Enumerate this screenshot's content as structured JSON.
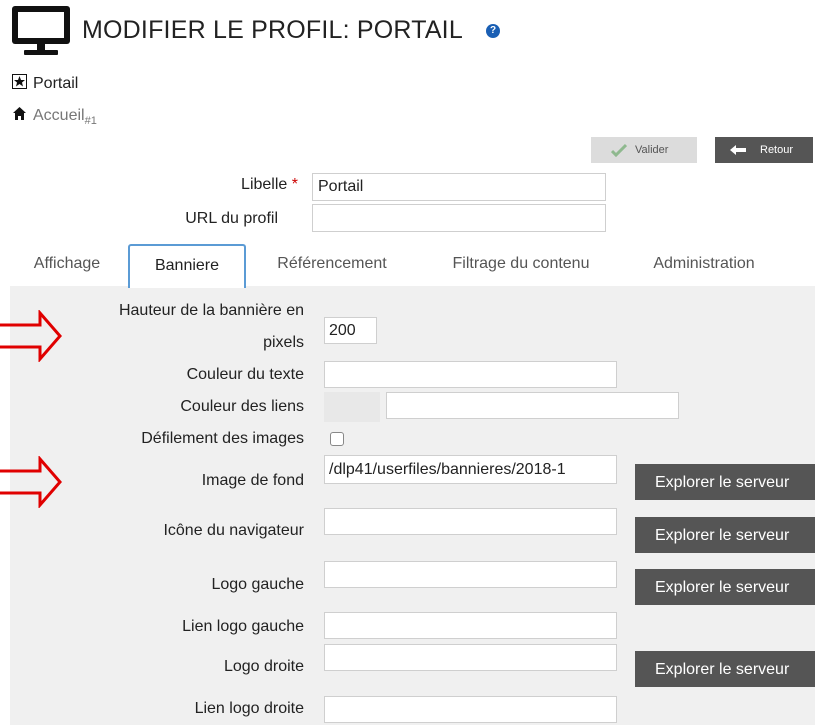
{
  "header": {
    "title": "MODIFIER LE PROFIL: PORTAIL",
    "help_icon": "?"
  },
  "breadcrumbs": {
    "portal": "Portail",
    "home": "Accueil",
    "home_id": "#1"
  },
  "actions": {
    "validate_label": "Valider",
    "back_label": "Retour"
  },
  "fields": {
    "libelle_label": "Libelle",
    "required_mark": "*",
    "libelle_value": "Portail",
    "url_label": "URL du profil",
    "url_value": ""
  },
  "tabs": [
    {
      "label": "Affichage"
    },
    {
      "label": "Banniere"
    },
    {
      "label": "Référencement"
    },
    {
      "label": "Filtrage du contenu"
    },
    {
      "label": "Administration"
    }
  ],
  "active_tab": "Banniere",
  "banner": {
    "height_label_line1": "Hauteur de la bannière en",
    "height_label_line2": "pixels",
    "height_value": "200",
    "text_color_label": "Couleur du texte",
    "text_color_value": "",
    "link_color_label": "Couleur des liens",
    "link_color_value": "",
    "scroll_label": "Défilement des images",
    "scroll_checked": false,
    "bg_image_label": "Image de fond",
    "bg_image_value": "/dlp41/userfiles/bannieres/2018-1",
    "favicon_label": "Icône du navigateur",
    "favicon_value": "",
    "left_logo_label": "Logo gauche",
    "left_logo_value": "",
    "left_logo_link_label": "Lien logo gauche",
    "left_logo_link_value": "",
    "right_logo_label": "Logo droite",
    "right_logo_value": "",
    "right_logo_link_label": "Lien logo droite",
    "right_logo_link_value": "",
    "explore_label": "Explorer le serveur"
  },
  "colors": {
    "annotation_arrow": "#e00000",
    "panel_bg": "#f0f0f0",
    "active_tab_border": "#5b9bd5",
    "dark_button": "#555555",
    "required": "#cc0000"
  },
  "icons": {
    "header": "monitor-icon",
    "portal": "portal-icon",
    "home": "home-icon",
    "validate": "check-icon",
    "back": "back-arrow-icon",
    "annotation": "red-arrow-icon"
  }
}
